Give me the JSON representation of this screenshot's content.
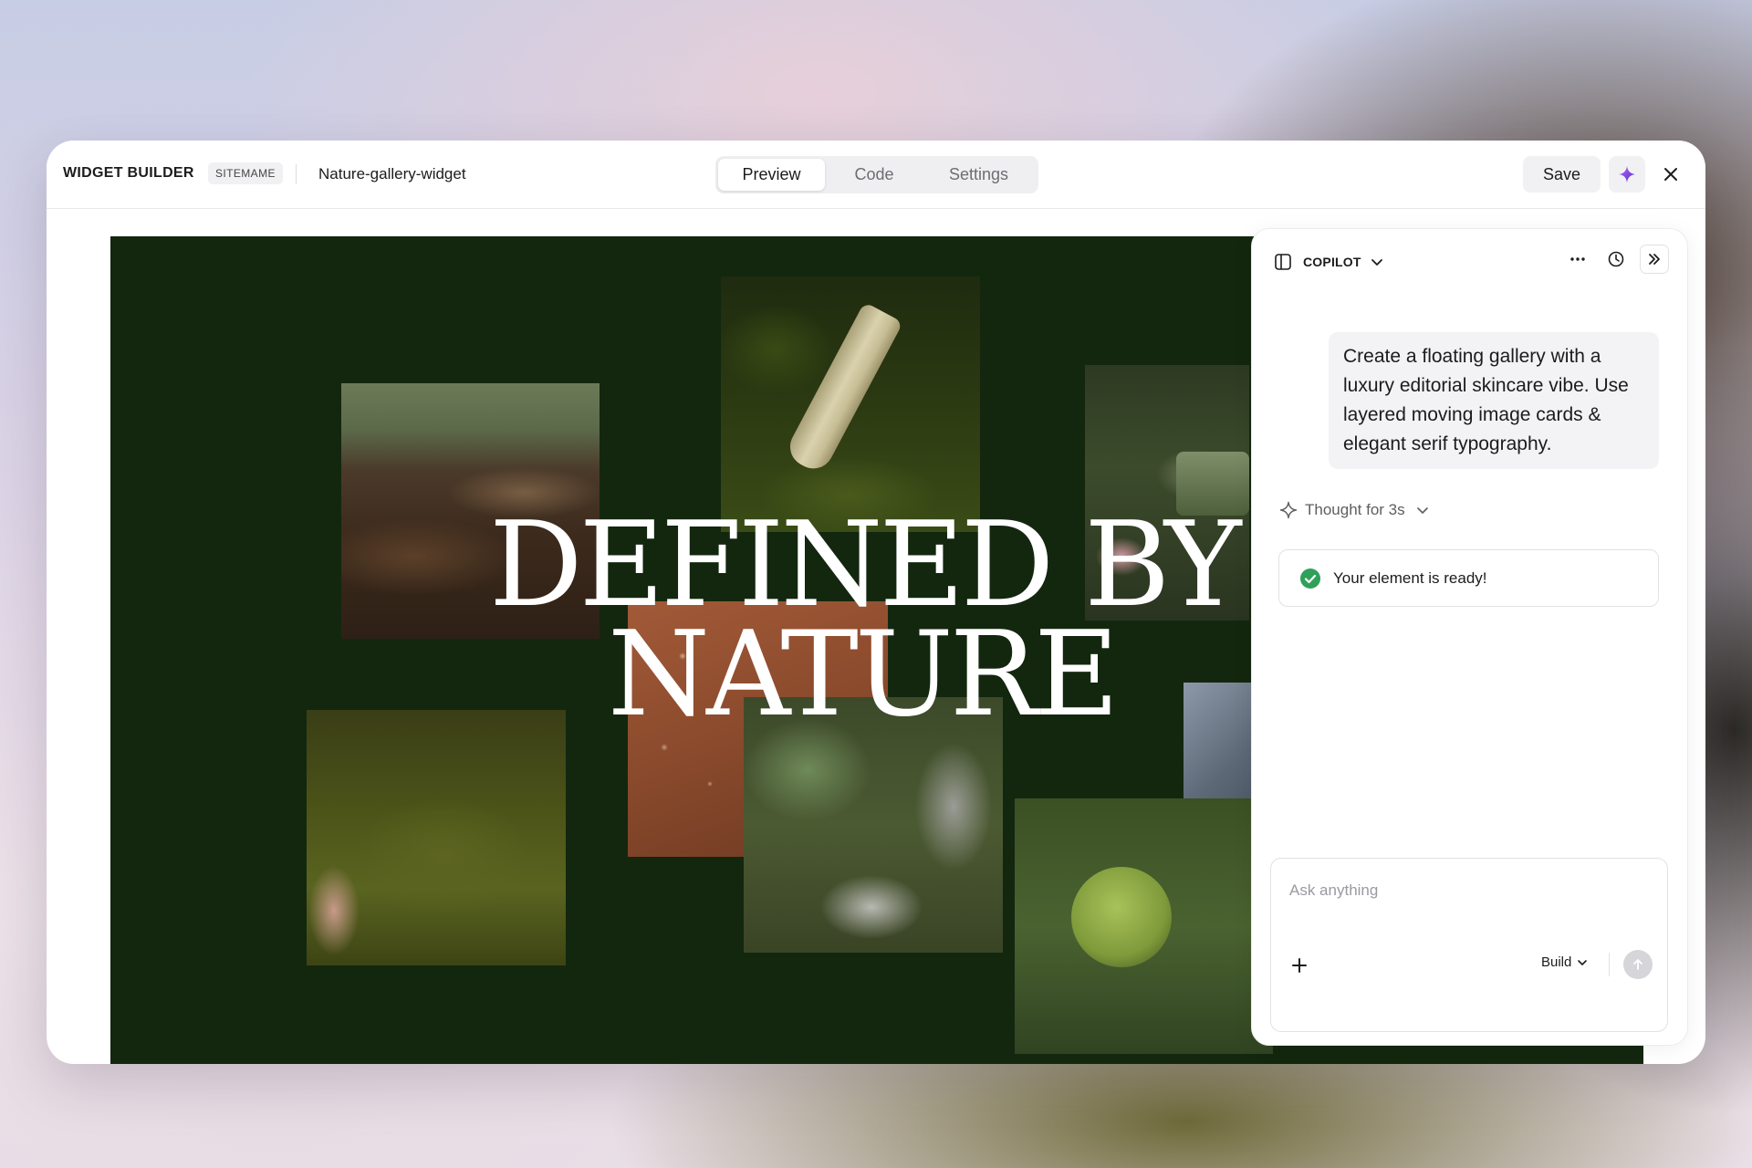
{
  "header": {
    "brand": "WIDGET BUILDER",
    "site_badge": "SITEMAME",
    "file_name": "Nature-gallery-widget",
    "tabs": [
      {
        "label": "Preview",
        "active": true
      },
      {
        "label": "Code",
        "active": false
      },
      {
        "label": "Settings",
        "active": false
      }
    ],
    "save_label": "Save",
    "sparkle_icon": "sparkle-icon",
    "close_icon": "close-icon"
  },
  "canvas": {
    "background": "#13270f",
    "headline_line1": "DEFINED BY",
    "headline_line2": "NATURE"
  },
  "copilot": {
    "title": "COPILOT",
    "user_message": "Create a floating gallery with a luxury editorial skincare vibe. Use layered moving image cards & elegant serif typography.",
    "thought_label": "Thought for 3s",
    "ready_message": "Your element is ready!",
    "input_placeholder": "Ask anything",
    "mode_label": "Build",
    "accent_color": "#7b3fe4",
    "success_color": "#2fa05a"
  }
}
